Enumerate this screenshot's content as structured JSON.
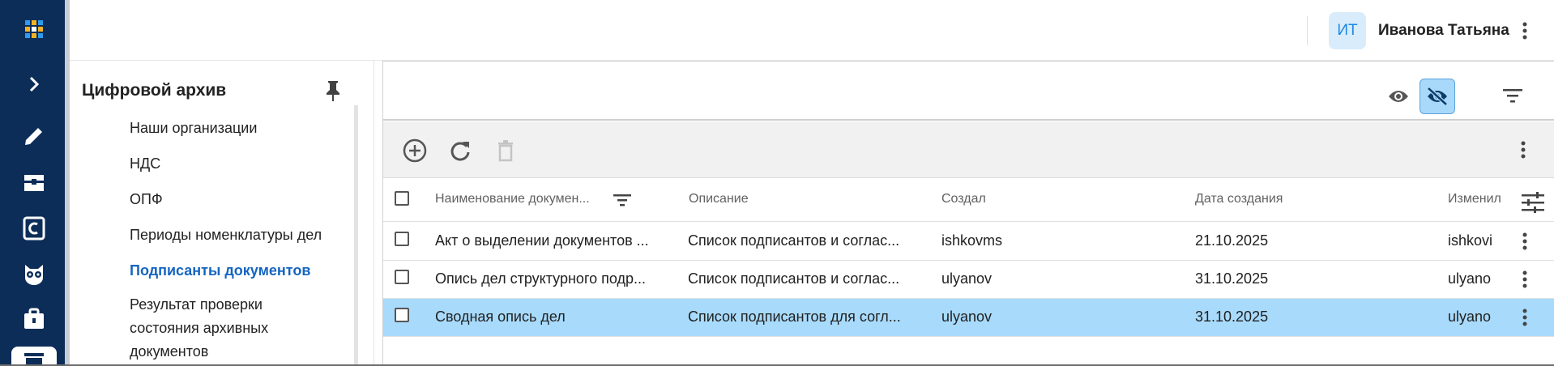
{
  "header": {
    "avatar_initials": "ИТ",
    "user_name": "Иванова Татьяна"
  },
  "rail": {
    "items": [
      {
        "icon": "apps-grid-icon"
      },
      {
        "icon": "chevron-right-icon"
      },
      {
        "icon": "pencil-icon"
      },
      {
        "icon": "archive-box-icon"
      },
      {
        "icon": "letter-c-icon"
      },
      {
        "icon": "owl-icon"
      },
      {
        "icon": "briefcase-icon"
      },
      {
        "icon": "tray-icon"
      }
    ]
  },
  "sidebar": {
    "title": "Цифровой архив",
    "items": [
      {
        "label": "Наши организации"
      },
      {
        "label": "НДС"
      },
      {
        "label": "ОПФ"
      },
      {
        "label": "Периоды номенклатуры дел"
      },
      {
        "label": "Подписанты документов",
        "active": true
      },
      {
        "label": "Результат проверки"
      },
      {
        "label": "состояния архивных"
      },
      {
        "label": "документов"
      }
    ]
  },
  "table": {
    "columns": [
      {
        "label": "Наименование докумен..."
      },
      {
        "label": "Описание"
      },
      {
        "label": "Создал"
      },
      {
        "label": "Дата создания"
      },
      {
        "label": "Изменил"
      }
    ],
    "rows": [
      {
        "name": "Акт о выделении документов ...",
        "description": "Список подписантов и соглас...",
        "created_by": "ishkovms",
        "created_date": "21.10.2025",
        "modified_by": "ishkovi"
      },
      {
        "name": "Опись дел структурного подр...",
        "description": "Список подписантов и соглас...",
        "created_by": "ulyanov",
        "created_date": "31.10.2025",
        "modified_by": "ulyano"
      },
      {
        "name": "Сводная опись дел",
        "description": "Список подписантов для согл...",
        "created_by": "ulyanov",
        "created_date": "31.10.2025",
        "modified_by": "ulyano",
        "selected": true
      }
    ]
  },
  "colors": {
    "rail_bg": "#0c2d58",
    "accent": "#1565c0",
    "selected_row": "#a8dafb",
    "avatar_bg": "#d8ecfb"
  }
}
